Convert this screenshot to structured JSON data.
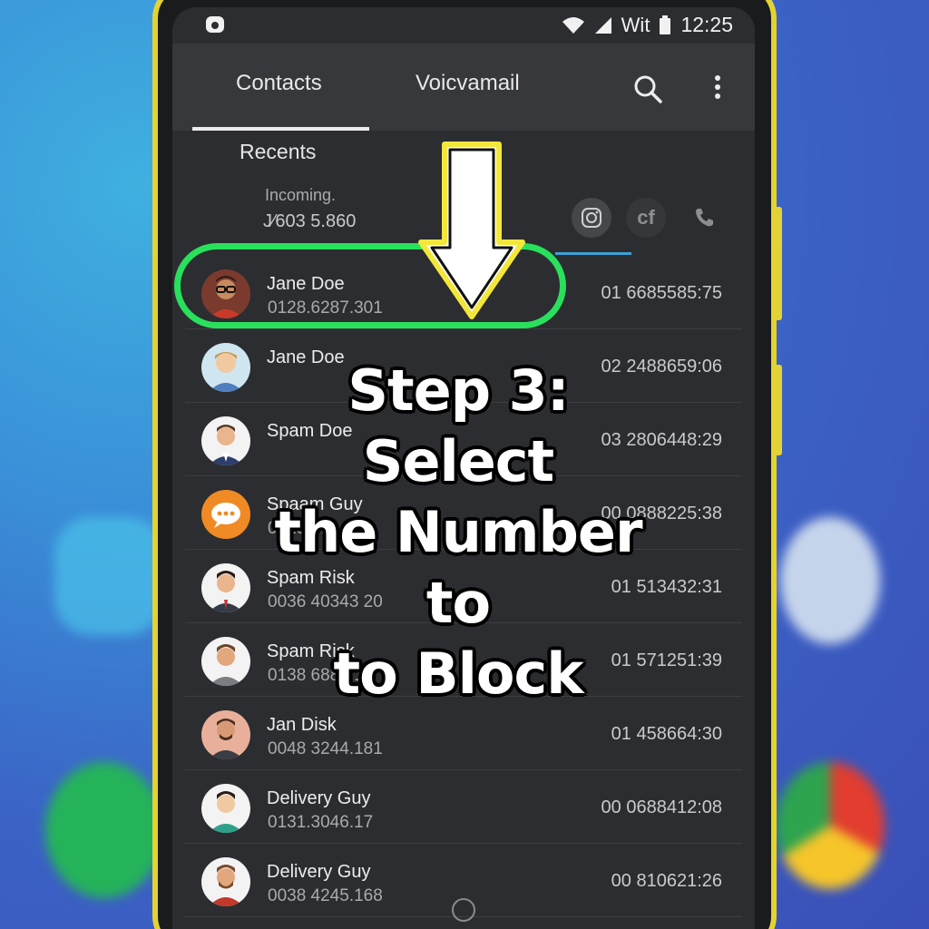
{
  "status_bar": {
    "carrier": "Wit",
    "time": "12:25"
  },
  "tabs": [
    {
      "label": "Contacts",
      "active": true
    },
    {
      "label": "Voicvamail",
      "active": false
    }
  ],
  "icons": {
    "search": "search-icon",
    "menu": "more-vert-icon"
  },
  "section_title": "Recents",
  "incoming": {
    "label": "Incoming.",
    "number": "J⁄603 5.860"
  },
  "filter_chips": [
    "instagram-icon",
    "facebook-icon",
    "phone-icon"
  ],
  "contacts": [
    {
      "name": "Jane Doe",
      "number": "0128.6287.301",
      "time": "01 6685585:75",
      "avatar_color": "#7a3b2e"
    },
    {
      "name": "Jane Doe",
      "number": "",
      "time": "02 2488659:06",
      "avatar_color": "#cfe6f0"
    },
    {
      "name": "Spam Doe",
      "number": "",
      "time": "03 2806448:29",
      "avatar_color": "#f3f3f3"
    },
    {
      "name": "Spaam Guy",
      "number": "0123 3(",
      "time": "00 0888225:38",
      "avatar_color": "#f08a24"
    },
    {
      "name": "Spam Risk",
      "number": "0036 40343 20",
      "time": "01 513432:31",
      "avatar_color": "#f3f3f3"
    },
    {
      "name": "Spam Risk",
      "number": "0138 6888.19",
      "time": "01 571251:39",
      "avatar_color": "#f3f3f3"
    },
    {
      "name": "Jan Disk",
      "number": "0048 3244.181",
      "time": "01 458664:30",
      "avatar_color": "#e8b09a"
    },
    {
      "name": "Delivery Guy",
      "number": "0131.3046.17",
      "time": "00 0688412:08",
      "avatar_color": "#f3f3f3"
    },
    {
      "name": "Delivery Guy",
      "number": "0038 4245.168",
      "time": "00 810621:26",
      "avatar_color": "#f3f3f3"
    }
  ],
  "overlay": {
    "caption_lines": [
      "Step 3: Select",
      "the Number to",
      "to Block"
    ],
    "highlight_color": "#29e05c",
    "arrow_color": "#f2e73a"
  }
}
